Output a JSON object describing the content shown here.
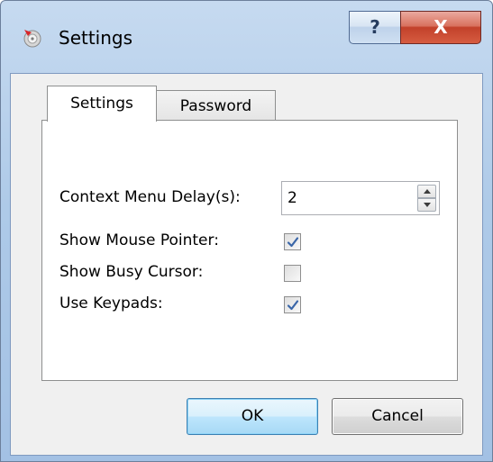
{
  "window": {
    "title": "Settings",
    "help_label": "?",
    "close_label": "X"
  },
  "tabs": [
    {
      "label": "Settings",
      "selected": true
    },
    {
      "label": "Password",
      "selected": false
    }
  ],
  "form": {
    "context_menu_delay": {
      "label": "Context Menu Delay(s):",
      "value": "2"
    },
    "show_mouse_pointer": {
      "label": "Show Mouse Pointer:",
      "checked": true
    },
    "show_busy_cursor": {
      "label": "Show Busy Cursor:",
      "checked": false
    },
    "use_keypads": {
      "label": "Use Keypads:",
      "checked": true
    }
  },
  "buttons": {
    "ok_label": "OK",
    "cancel_label": "Cancel"
  },
  "colors": {
    "title_bar": "#a9c6e8",
    "close_button": "#c74b33",
    "checkmark": "#3a66a8",
    "ok_highlight": "#bee6fd"
  }
}
